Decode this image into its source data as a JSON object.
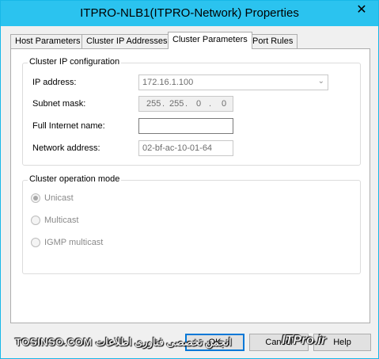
{
  "window": {
    "title": "ITPRO-NLB1(ITPRO-Network) Properties",
    "close_glyph": "✕"
  },
  "tabs": [
    {
      "label": "Host Parameters",
      "active": false
    },
    {
      "label": "Cluster IP Addresses",
      "active": false
    },
    {
      "label": "Cluster Parameters",
      "active": true
    },
    {
      "label": "Port Rules",
      "active": false
    }
  ],
  "cluster_ip_config": {
    "group_title": "Cluster IP configuration",
    "ip_address": {
      "label": "IP address:",
      "value": "172.16.1.100"
    },
    "subnet_mask": {
      "label": "Subnet mask:",
      "octets": [
        "255",
        "255",
        "0",
        "0"
      ]
    },
    "full_internet_name": {
      "label": "Full Internet name:",
      "value": ""
    },
    "network_address": {
      "label": "Network address:",
      "value": "02-bf-ac-10-01-64"
    }
  },
  "cluster_operation_mode": {
    "group_title": "Cluster operation mode",
    "options": [
      {
        "label": "Unicast",
        "checked": true
      },
      {
        "label": "Multicast",
        "checked": false
      },
      {
        "label": "IGMP multicast",
        "checked": false
      }
    ]
  },
  "buttons": {
    "ok": "OK",
    "cancel": "Cancel",
    "help": "Help"
  },
  "watermark": {
    "left": "TOSINSO.COM انجمن تخصصی فناوری اطلاعات",
    "right": "ITPro.ir"
  }
}
